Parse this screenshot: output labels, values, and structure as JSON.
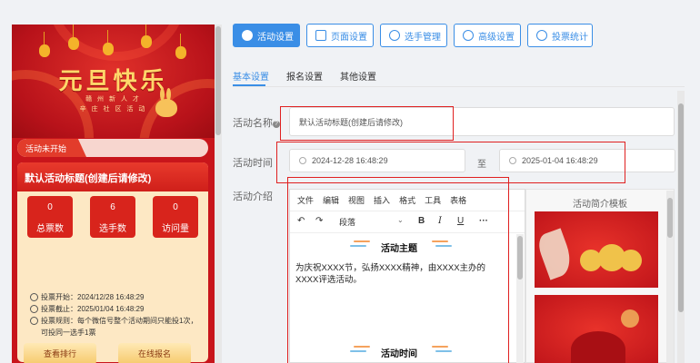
{
  "preview": {
    "banner_title": "元旦快乐",
    "banner_sub1": "赣 州 新 人 才",
    "banner_sub2": "辛 庄 社 区 活 动",
    "status": "活动未开始",
    "activity_title": "默认活动标题(创建后请修改)",
    "stats": [
      {
        "value": "0",
        "label": "总票数"
      },
      {
        "value": "6",
        "label": "选手数"
      },
      {
        "value": "0",
        "label": "访问量"
      }
    ],
    "vote_start": "投票开始：2024/12/28 16:48:29",
    "vote_end": "投票截止：2025/01/04 16:48:29",
    "vote_rule": "投票规则：每个微信号整个活动期间只能投1次，可投同一选手1票",
    "buttons": {
      "ranking": "查看排行",
      "signup": "在线报名"
    }
  },
  "toolbar": [
    {
      "label": "活动设置",
      "icon": "star-icon",
      "active": true
    },
    {
      "label": "页面设置",
      "icon": "page-icon",
      "active": false
    },
    {
      "label": "选手管理",
      "icon": "users-icon",
      "active": false
    },
    {
      "label": "高级设置",
      "icon": "pie-icon",
      "active": false
    },
    {
      "label": "投票统计",
      "icon": "search-icon",
      "active": false
    }
  ],
  "subtabs": [
    "基本设置",
    "报名设置",
    "其他设置"
  ],
  "form": {
    "name_label": "活动名称",
    "name_value": "默认活动标题(创建后请修改)",
    "time_label": "活动时间",
    "start_time": "2024-12-28 16:48:29",
    "to": "至",
    "end_time": "2025-01-04 16:48:29",
    "intro_label": "活动介绍"
  },
  "editor": {
    "menu": [
      "文件",
      "编辑",
      "视图",
      "插入",
      "格式",
      "工具",
      "表格"
    ],
    "paragraph": "段落",
    "heading1": "活动主题",
    "body": "为庆祝XXXX节，弘扬XXXX精神，由XXXX主办的XXXX评选活动。",
    "heading2": "活动时间"
  },
  "template": {
    "title": "活动简介模板"
  },
  "colors": {
    "accent": "#3a8ee6",
    "preview_red": "#c8151b",
    "highlight": "#e02020"
  }
}
